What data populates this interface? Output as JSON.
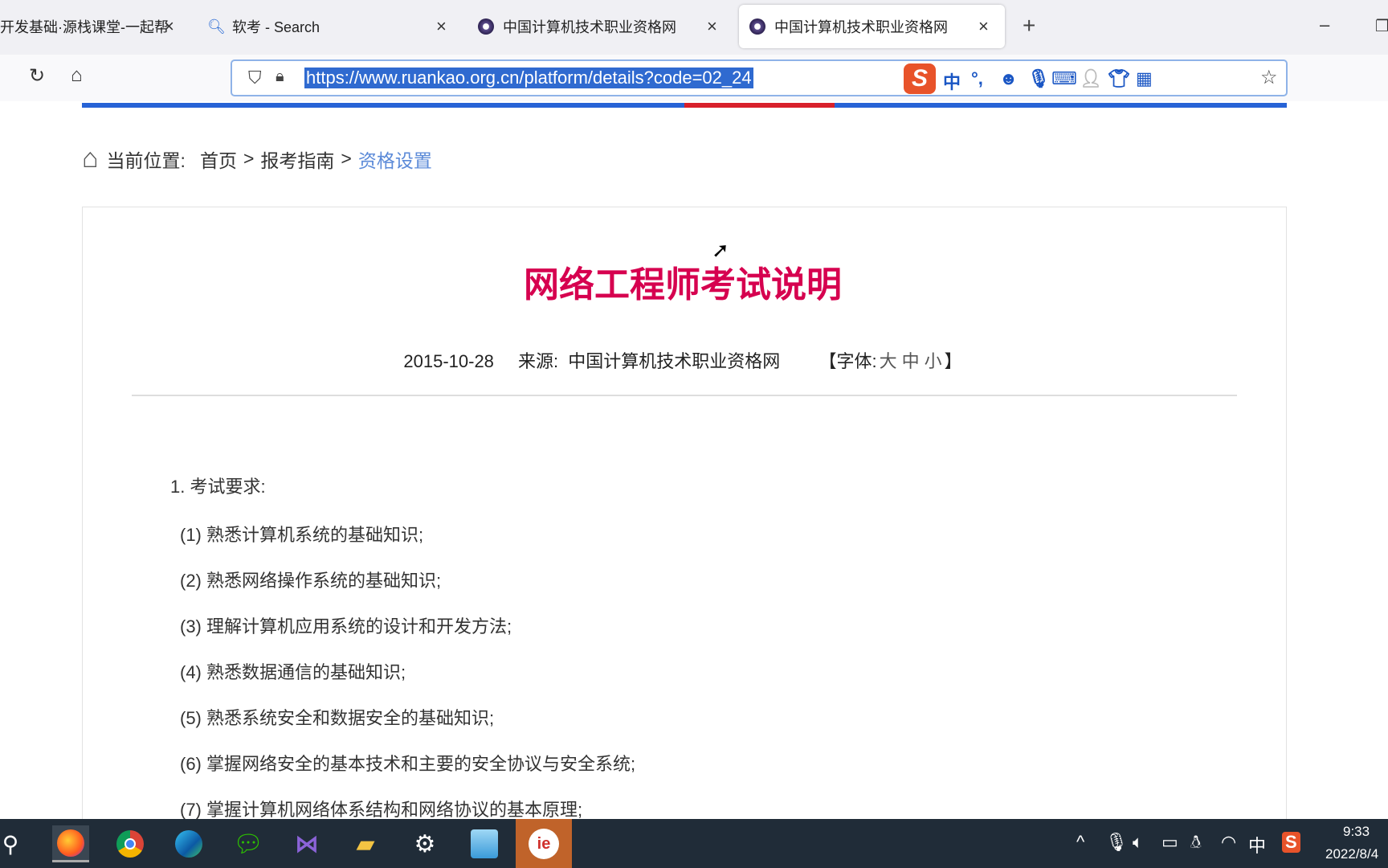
{
  "browser": {
    "tabs": [
      {
        "label": "开发基础·源栈课堂-一起帮",
        "icon": "page-icon"
      },
      {
        "label": "软考 - Search",
        "icon": "search-icon"
      },
      {
        "label": "中国计算机技术职业资格网",
        "icon": "site-favicon"
      },
      {
        "label": "中国计算机技术职业资格网",
        "icon": "site-favicon",
        "active": true
      }
    ],
    "close_glyph": "×",
    "new_tab_glyph": "+",
    "minimize_glyph": "–",
    "restore_glyph": "❐",
    "url": "https://www.ruankao.org.cn/platform/details?code=02_24",
    "ime_toolbar": {
      "logo": "S",
      "mode": "中",
      "punct": "°,"
    }
  },
  "breadcrumb": {
    "label": "当前位置:",
    "items": [
      "首页",
      "报考指南",
      "资格设置"
    ],
    "separator": ">"
  },
  "article": {
    "title": "网络工程师考试说明",
    "date": "2015-10-28",
    "source_label": "来源:",
    "source": "中国计算机技术职业资格网",
    "font_label": "【字体:",
    "font_sizes": [
      "大",
      "中",
      "小"
    ],
    "font_close": "】",
    "section": "1. 考试要求:",
    "items": [
      "(1) 熟悉计算机系统的基础知识;",
      "(2) 熟悉网络操作系统的基础知识;",
      "(3) 理解计算机应用系统的设计和开发方法;",
      "(4) 熟悉数据通信的基础知识;",
      "(5) 熟悉系统安全和数据安全的基础知识;",
      "(6) 掌握网络安全的基本技术和主要的安全协议与安全系统;",
      "(7) 掌握计算机网络体系结构和网络协议的基本原理;"
    ]
  },
  "taskbar": {
    "time": "9:33",
    "date": "2022/8/4",
    "ime": "中",
    "colors": {
      "bg": "#202c38",
      "active": "#c0632a"
    }
  }
}
